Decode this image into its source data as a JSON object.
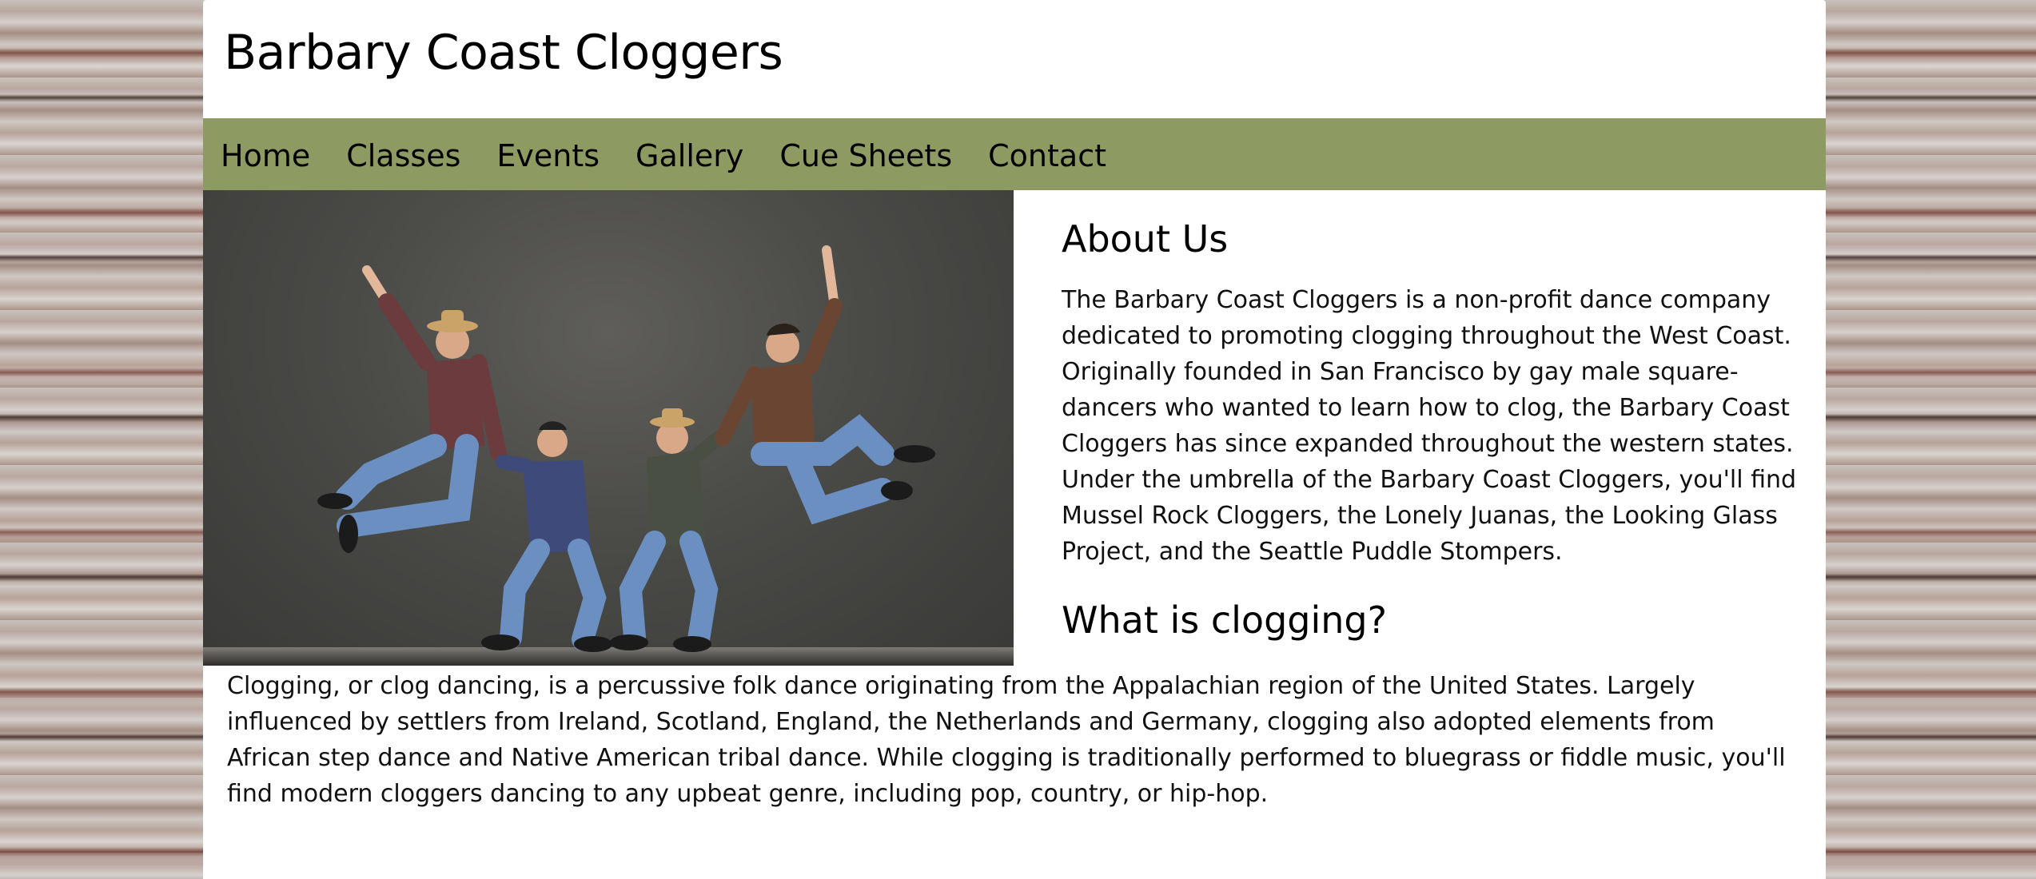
{
  "site": {
    "title": "Barbary Coast Cloggers"
  },
  "nav": {
    "items": [
      {
        "label": "Home"
      },
      {
        "label": "Classes"
      },
      {
        "label": "Events"
      },
      {
        "label": "Gallery"
      },
      {
        "label": "Cue Sheets"
      },
      {
        "label": "Contact"
      }
    ]
  },
  "hero": {
    "description": "Four cloggers in plaid shirts and jeans leaping on a dark stage"
  },
  "about": {
    "heading": "About Us",
    "text": "The Barbary Coast Cloggers is a non-profit dance company dedicated to promoting clogging throughout the West Coast. Originally founded in San Francisco by gay male square-dancers who wanted to learn how to clog, the Barbary Coast Cloggers has since expanded throughout the western states. Under the umbrella of the Barbary Coast Cloggers, you'll find Mussel Rock Cloggers, the Lonely Juanas, the Looking Glass Project, and the Seattle Puddle Stompers."
  },
  "clogging": {
    "heading": "What is clogging?",
    "text": "Clogging, or clog dancing, is a percussive folk dance originating from the Appalachian region of the United States. Largely influenced by settlers from Ireland, Scotland, England, the Netherlands and Germany, clogging also adopted elements from African step dance and Native American tribal dance. While clogging is traditionally performed to bluegrass or fiddle music, you'll find modern cloggers dancing to any upbeat genre, including pop, country, or hip-hop."
  },
  "colors": {
    "nav_background": "#8d9b63",
    "page_background": "#ffffff",
    "text": "#000000"
  }
}
